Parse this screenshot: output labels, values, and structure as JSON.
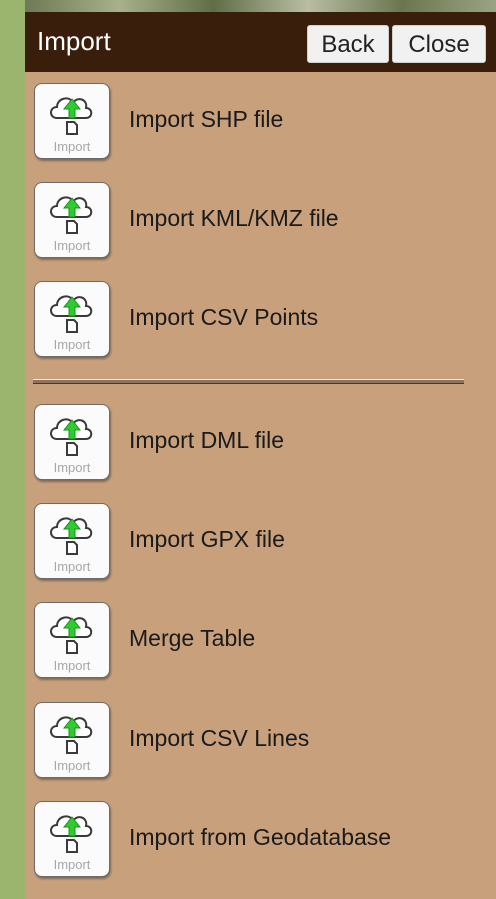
{
  "panel": {
    "title": "Import",
    "back_label": "Back",
    "close_label": "Close"
  },
  "icon_caption": "Import",
  "icon_name": "cloud-upload-icon",
  "colors": {
    "header_bg": "#3a1e0c",
    "panel_bg": "#c8a07c",
    "arrow": "#2ecc2e"
  },
  "items_group1": [
    {
      "label": "Import SHP file"
    },
    {
      "label": "Import KML/KMZ file"
    },
    {
      "label": "Import CSV Points"
    }
  ],
  "items_group2": [
    {
      "label": "Import DML file"
    },
    {
      "label": "Import GPX file"
    },
    {
      "label": "Merge Table"
    },
    {
      "label": "Import CSV Lines"
    },
    {
      "label": "Import from Geodatabase"
    }
  ]
}
